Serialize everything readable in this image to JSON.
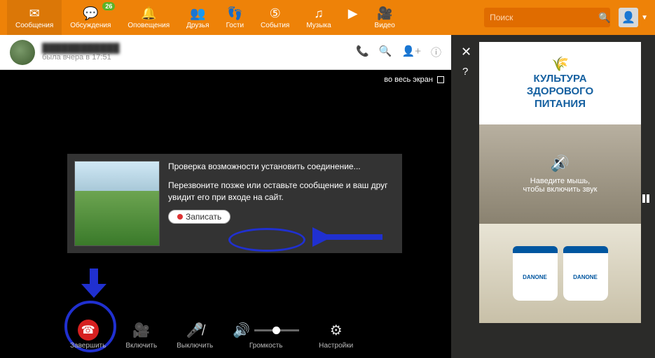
{
  "nav": {
    "items": [
      {
        "label": "Сообщения"
      },
      {
        "label": "Обсуждения",
        "badge": "26"
      },
      {
        "label": "Оповещения"
      },
      {
        "label": "Друзья"
      },
      {
        "label": "Гости"
      },
      {
        "label": "События"
      },
      {
        "label": "Музыка"
      },
      {
        "label": "Видео"
      }
    ]
  },
  "search": {
    "placeholder": "Поиск"
  },
  "chat": {
    "user_name": "████████████",
    "user_status": "была вчера в 17:51"
  },
  "call": {
    "fullscreen": "во весь экран",
    "msg_title": "Проверка возможности установить соединение...",
    "msg_body": "Перезвоните позже или оставьте сообщение и ваш друг увидит его при входе на сайт.",
    "record": "Записать"
  },
  "controls": {
    "end": "Завершить",
    "cam_on": "Включить",
    "mic_off": "Выключить",
    "volume": "Громкость",
    "settings": "Настройки"
  },
  "ads": {
    "ad1_line1": "КУЛЬТУРА",
    "ad1_line2": "ЗДОРОВОГО",
    "ad1_line3": "ПИТАНИЯ",
    "ad2_line1": "Наведите мышь,",
    "ad2_line2": "чтобы включить звук",
    "ad3_brand": "DANONE"
  }
}
